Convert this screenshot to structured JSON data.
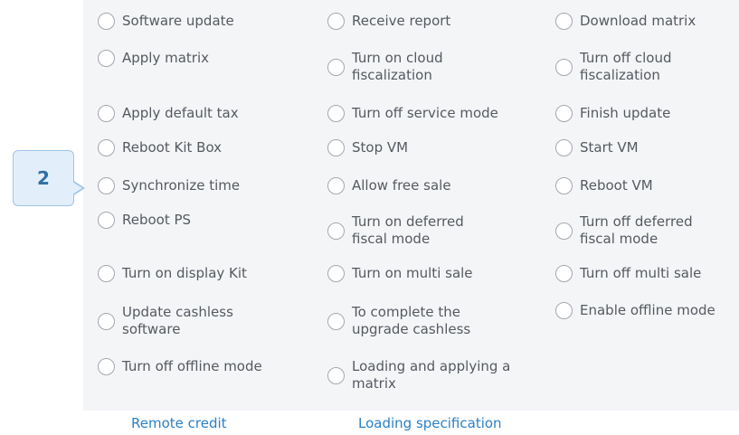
{
  "callout": {
    "number": "2"
  },
  "options": {
    "software_update": "Software update",
    "receive_report": "Receive report",
    "download_matrix": "Download matrix",
    "apply_matrix": "Apply matrix",
    "turn_on_cloud_fiscalization": "Turn on cloud fiscalization",
    "turn_off_cloud_fiscalization": "Turn off cloud fiscalization",
    "apply_default_tax": "Apply default tax",
    "turn_off_service_mode": "Turn off service mode",
    "finish_update": "Finish update",
    "reboot_kit_box": "Reboot Kit Box",
    "stop_vm": "Stop VM",
    "start_vm": "Start VM",
    "synchronize_time": "Synchronize time",
    "allow_free_sale": "Allow free sale",
    "reboot_vm": "Reboot VM",
    "reboot_ps": "Reboot PS",
    "turn_on_deferred_fiscal_mode": "Turn on deferred fiscal mode",
    "turn_off_deferred_fiscal_mode": "Turn off deferred fiscal mode",
    "turn_on_display_kit": "Turn on display Kit",
    "turn_on_multi_sale": "Turn on multi sale",
    "turn_off_multi_sale": "Turn off multi sale",
    "update_cashless_software": "Update cashless software",
    "complete_upgrade_cashless": "To complete the upgrade cashless",
    "enable_offline_mode": "Enable offline mode",
    "turn_off_offline_mode": "Turn off offline mode",
    "loading_applying_matrix": "Loading and applying a matrix"
  },
  "links": {
    "remote_credit": "Remote credit",
    "loading_specification": "Loading specification"
  }
}
